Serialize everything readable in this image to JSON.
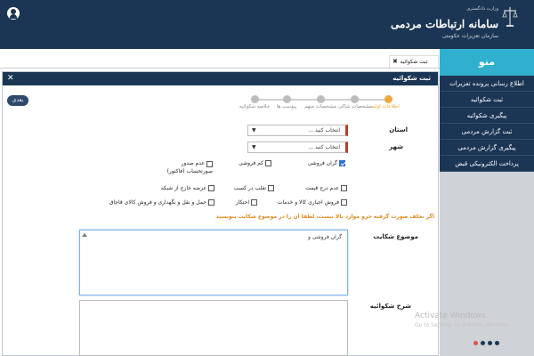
{
  "header": {
    "title": "سامانه ارتباطات مردمی",
    "org_line1": "وزارت دادگستری",
    "org_line2": "سازمان تعزیرات حکومتی",
    "bg": "#1b3654"
  },
  "sidebar": {
    "title": "منو",
    "accent": "#30b0ce",
    "items": [
      {
        "label": "اطلاع رسانی پرونده تعزیرات"
      },
      {
        "label": "ثبت شکوائیه"
      },
      {
        "label": "پیگیری شکوائیه"
      },
      {
        "label": "ثبت گزارش مردمی"
      },
      {
        "label": "پیگیری گزارش مردمی"
      },
      {
        "label": "پرداخت الکترونیکی قبض"
      }
    ],
    "dot_colors": [
      "#d9534f",
      "#1b3654",
      "#1b3654",
      "#1b3654"
    ]
  },
  "tab": {
    "label": "ثبت شکوائیه"
  },
  "panel": {
    "title": "ثبت شکوائیه",
    "next_label": "بعدی",
    "steps": [
      {
        "label": "اطلاعات اولیه",
        "active": true
      },
      {
        "label": "مشخصات شاکی",
        "active": false
      },
      {
        "label": "مشخصات متهم",
        "active": false
      },
      {
        "label": "پیوست ها",
        "active": false
      },
      {
        "label": "خلاصه شکوائیه",
        "active": false
      }
    ]
  },
  "form": {
    "province_label": "استان",
    "province_value": "انتخاب کنید ...",
    "city_label": "شهر",
    "city_value": "انتخاب کنید ...",
    "complaint_types": [
      {
        "label": "گران فروشی",
        "checked": true
      },
      {
        "label": "کم فروشی",
        "checked": false
      },
      {
        "label": "عدم صدور صورتحساب (فاکتور)",
        "checked": false
      },
      {
        "label": "عدم درج قیمت",
        "checked": false
      },
      {
        "label": "تقلب در کسب",
        "checked": false
      },
      {
        "label": "عرضه خارج از شبکه",
        "checked": false
      },
      {
        "label": "فروش اجباری کالا و خدمات",
        "checked": false
      },
      {
        "label": "احتکار",
        "checked": false
      },
      {
        "label": "حمل و نقل و نگهداری و فروش کالای قاچاق",
        "checked": false
      }
    ],
    "warning": "اگر تخلف صورت گرفته جزو موارد بالا نیست، لطفا آن را در موضوع شکایت بنویسید",
    "subject_label": "موضوع شکایت",
    "subject_value": "گران فروشی و",
    "description_label": "شرح شکوائیه",
    "description_value": ""
  },
  "watermark": {
    "line1": "Activate Windows",
    "line2": "Go to Settings to activate Windows."
  }
}
